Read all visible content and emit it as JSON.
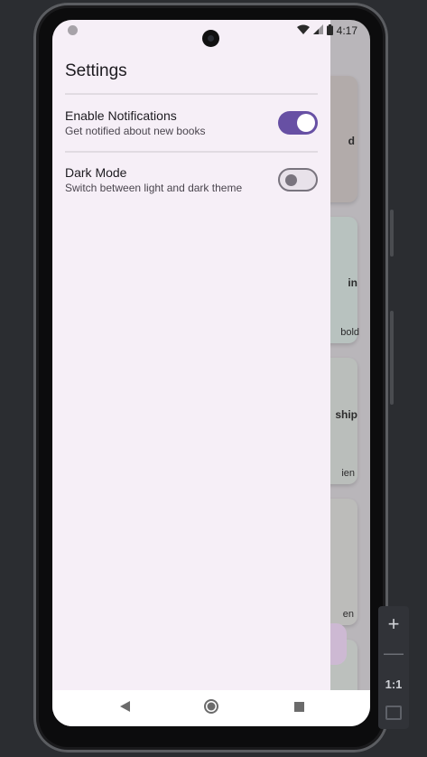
{
  "status_bar": {
    "time": "4:17"
  },
  "settings": {
    "title": "Settings",
    "items": [
      {
        "label": "Enable Notifications",
        "description": "Get notified about new books",
        "enabled": true
      },
      {
        "label": "Dark Mode",
        "description": "Switch between light and dark theme",
        "enabled": false
      }
    ]
  },
  "background_cards": [
    {
      "title_fragment": "d",
      "subtitle_fragment": ""
    },
    {
      "title_fragment": "in",
      "subtitle_fragment": "bold"
    },
    {
      "title_fragment": "ship",
      "subtitle_fragment": "ien"
    },
    {
      "title_fragment": "",
      "subtitle_fragment": "en"
    },
    {
      "title_fragment": "",
      "subtitle_fragment": ""
    }
  ],
  "emulator_controls": {
    "zoom_in": "+",
    "zoom_out": "—",
    "ratio": "1:1"
  },
  "colors": {
    "accent": "#6750a4",
    "drawer_background": "#f6eff7",
    "desktop_background": "#2b2d31"
  },
  "icons": [
    "wifi-icon",
    "signal-icon",
    "battery-icon",
    "back-icon",
    "home-icon",
    "recents-icon"
  ]
}
